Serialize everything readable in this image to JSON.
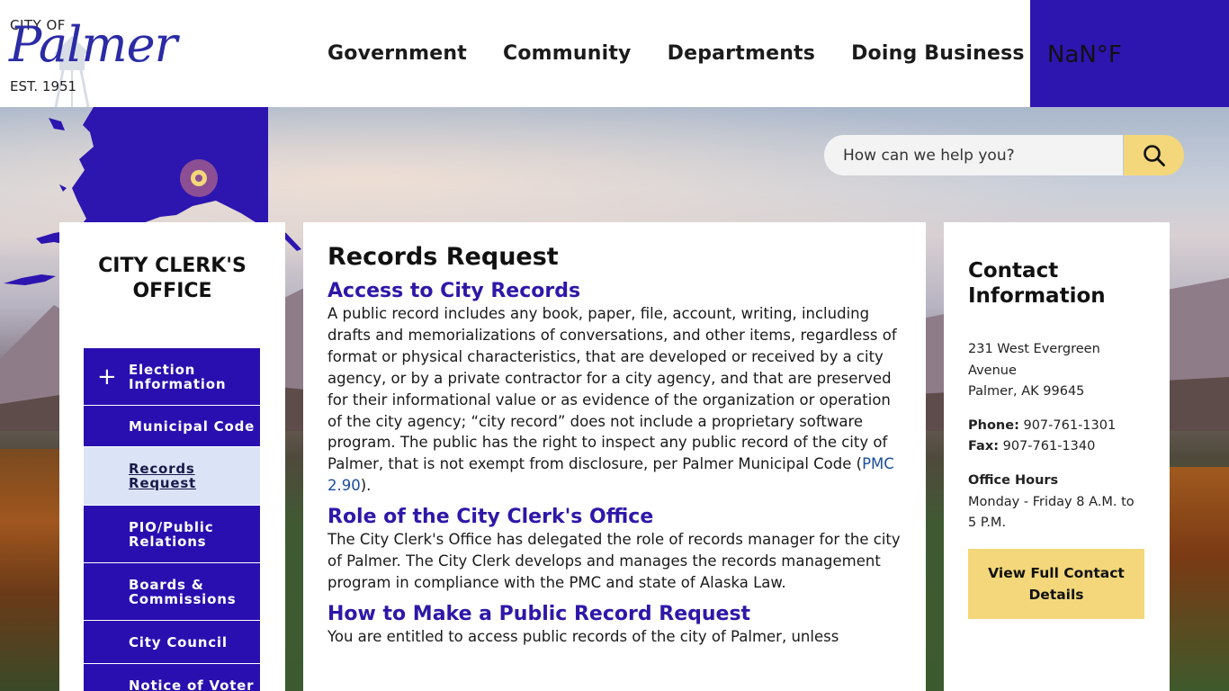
{
  "logo": {
    "city_of": "CITY OF",
    "name": "Palmer",
    "established": "EST. 1951"
  },
  "nav": [
    "Government",
    "Community",
    "Departments",
    "Doing Business"
  ],
  "weather": {
    "temperature": "NaN°F"
  },
  "search": {
    "placeholder": "How can we help you?",
    "icon": "search-icon"
  },
  "sidebar": {
    "title": "CITY CLERK'S OFFICE",
    "items": [
      {
        "label": "Election Information",
        "expandable": true,
        "active": false
      },
      {
        "label": "Municipal Code",
        "expandable": false,
        "active": false
      },
      {
        "label": "Records Request",
        "expandable": false,
        "active": true
      },
      {
        "label": "PIO/Public Relations",
        "expandable": false,
        "active": false
      },
      {
        "label": "Boards & Commissions",
        "expandable": false,
        "active": false
      },
      {
        "label": "City Council",
        "expandable": false,
        "active": false
      },
      {
        "label": "Notice of Voter",
        "expandable": false,
        "active": false
      }
    ]
  },
  "main": {
    "title": "Records Request",
    "sections": [
      {
        "heading": "Access to City Records",
        "text_before": "A public record includes any book, paper, file, account, writing, including drafts and memorializations of conversations, and other items, regardless of format or physical characteristics, that are developed or received by a city agency, or by a private contractor for a city agency, and that are preserved for their informational value or as evidence of the organization or operation of the city agency; “city record” does not include a proprietary software program. The public has the right to inspect any public record of the city of Palmer, that is not exempt from disclosure, per Palmer Municipal Code (",
        "link": "PMC 2.90",
        "text_after": ")."
      },
      {
        "heading": "Role of the City Clerk's Office",
        "text": "The City Clerk's Office has delegated the role of records manager for the city of Palmer. The City Clerk develops and manages the records management program in compliance with the PMC and state of Alaska Law."
      },
      {
        "heading": "How to Make a Public Record Request",
        "text": "You are entitled to access public records of the city of Palmer, unless"
      }
    ]
  },
  "contact": {
    "title": "Contact Information",
    "address_line1": "231 West Evergreen Avenue",
    "address_line2": "Palmer, AK 99645",
    "phone_label": "Phone:",
    "phone": "907-761-1301",
    "fax_label": "Fax:",
    "fax": "907-761-1340",
    "hours_label": "Office Hours",
    "hours": "Monday - Friday 8 A.M. to 5 P.M.",
    "button": "View Full Contact Details"
  },
  "colors": {
    "brand_purple": "#2d15b0",
    "accent_yellow": "#f3d77a",
    "heading_blue": "#2d18a8",
    "link_blue": "#1a4c9e"
  }
}
